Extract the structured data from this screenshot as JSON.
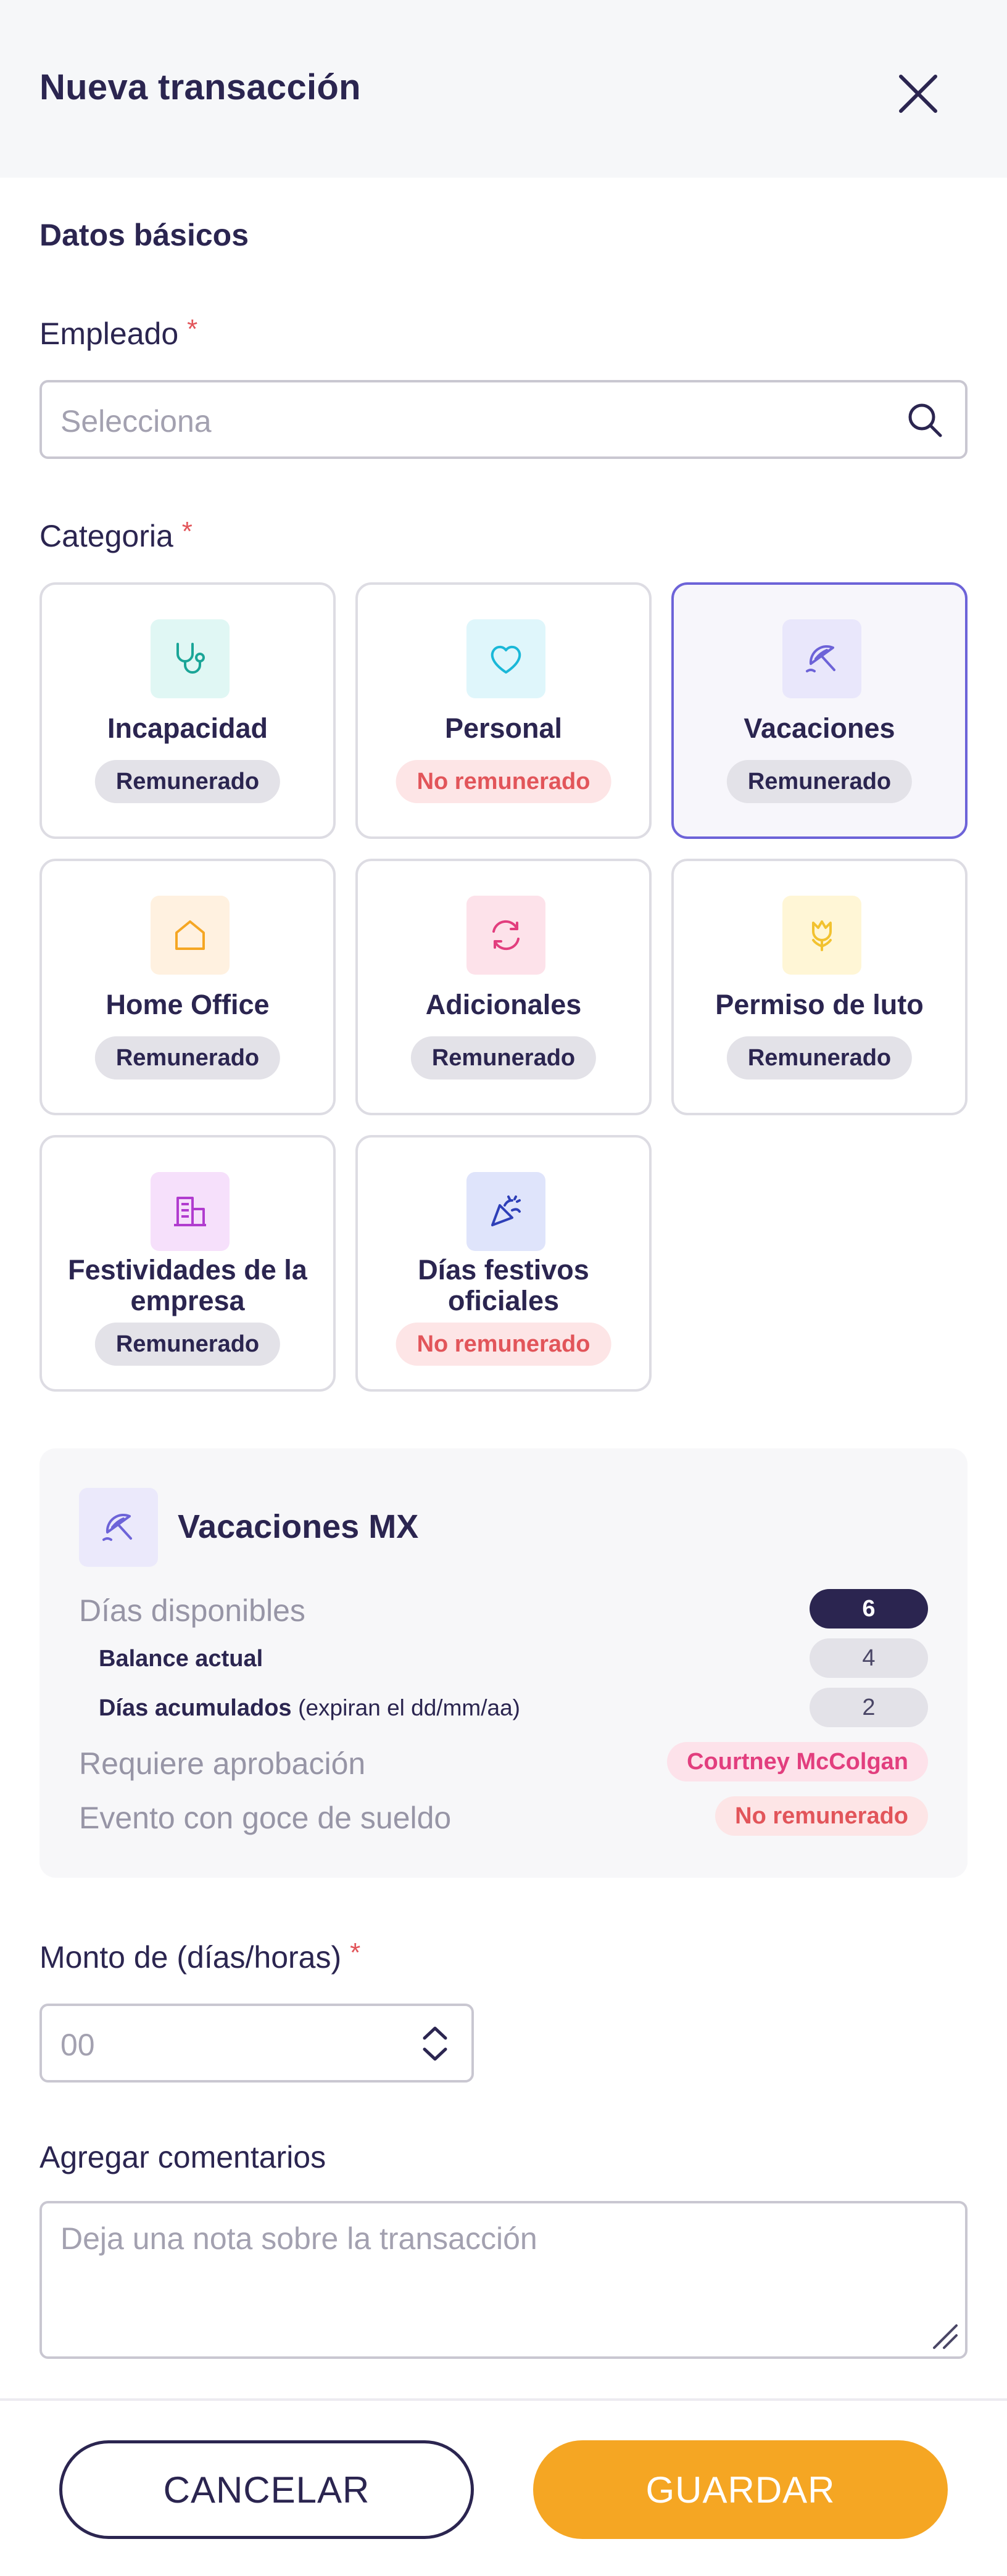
{
  "header": {
    "title": "Nueva transacción"
  },
  "section": {
    "title": "Datos básicos"
  },
  "employee": {
    "label": "Empleado",
    "required": "*",
    "placeholder": "Selecciona"
  },
  "category": {
    "label": "Categoria",
    "required": "*",
    "items": [
      {
        "name": "Incapacidad",
        "badge": "Remunerado"
      },
      {
        "name": "Personal",
        "badge": "No remunerado"
      },
      {
        "name": "Vacaciones",
        "badge": "Remunerado"
      },
      {
        "name": "Home Office",
        "badge": "Remunerado"
      },
      {
        "name": "Adicionales",
        "badge": "Remunerado"
      },
      {
        "name": "Permiso de luto",
        "badge": "Remunerado"
      },
      {
        "name": "Festividades de la empresa",
        "badge": "Remunerado"
      },
      {
        "name": "Días festivos oficiales",
        "badge": "No remunerado"
      }
    ]
  },
  "info": {
    "title": "Vacaciones MX",
    "available_label": "Días disponibles",
    "available_value": "6",
    "balance_label": "Balance actual",
    "balance_value": "4",
    "accrued_label": "Días acumulados",
    "accrued_note": "(expiran el dd/mm/aa)",
    "accrued_value": "2",
    "approval_label": "Requiere aprobación",
    "approval_value": "Courtney McColgan",
    "paid_label": "Evento con goce de sueldo",
    "paid_value": "No remunerado"
  },
  "amount": {
    "label": "Monto de (días/horas)",
    "required": "*",
    "placeholder": "00"
  },
  "comments": {
    "label": "Agregar comentarios",
    "placeholder": "Deja una nota sobre la transacción"
  },
  "footer": {
    "cancel_label": "CANCELAR",
    "save_label": "GUARDAR"
  }
}
